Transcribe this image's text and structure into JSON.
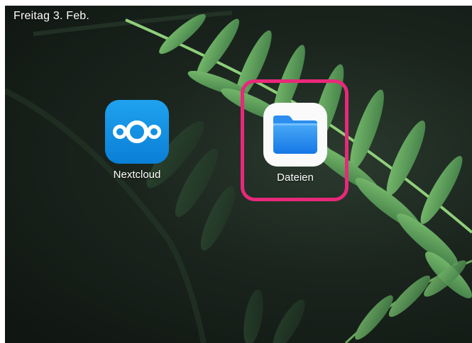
{
  "status_bar": {
    "date": "Freitag 3. Feb."
  },
  "apps": [
    {
      "label": "Nextcloud",
      "icon": "nextcloud-logo-icon",
      "color": "#0a82dc"
    },
    {
      "label": "Dateien",
      "icon": "folder-icon",
      "color": "#1e90f0"
    }
  ],
  "highlight": {
    "target": "Dateien",
    "color": "#e8287a"
  },
  "wallpaper": {
    "subject": "fern",
    "colors": [
      "#1a241d",
      "#4f8f56",
      "#7cbf6a"
    ]
  }
}
